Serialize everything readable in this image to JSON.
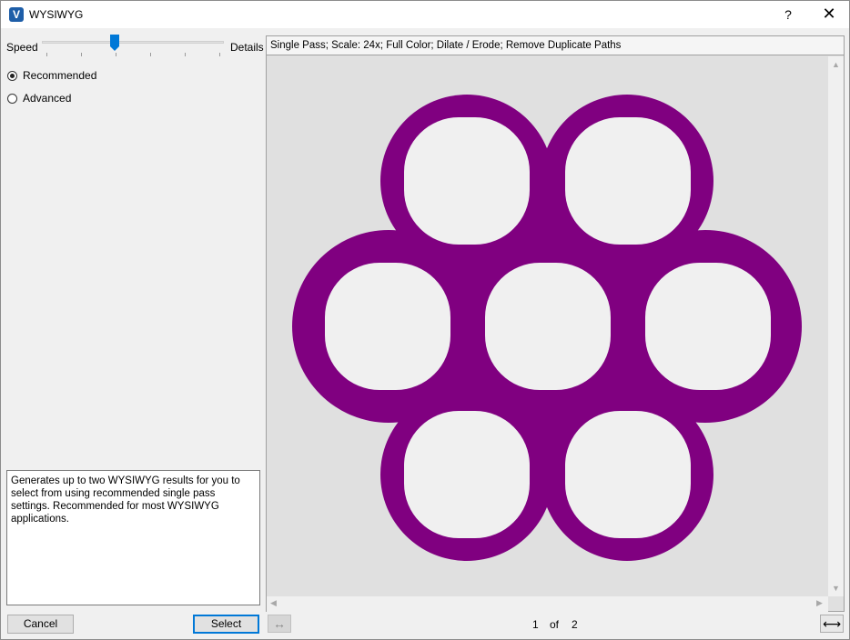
{
  "window": {
    "title": "WYSIWYG",
    "app_icon_letter": "V",
    "help_label": "?",
    "close_label": "✕"
  },
  "left_panel": {
    "slider": {
      "left_label": "Speed",
      "right_label": "Details",
      "value_fraction": 0.4
    },
    "radios": [
      {
        "label": "Recommended",
        "checked": true
      },
      {
        "label": "Advanced",
        "checked": false
      }
    ],
    "description": "Generates up to two WYSIWYG results for you to select from using recommended single pass settings. Recommended for most WYSIWYG applications."
  },
  "buttons": {
    "cancel": "Cancel",
    "select": "Select"
  },
  "preview": {
    "info": "Single Pass; Scale: 24x; Full Color; Dilate / Erode; Remove Duplicate Paths",
    "shape_color": "#800080",
    "hole_color": "#f0f0f0",
    "background_color": "#e0e0e0"
  },
  "pager": {
    "current": "1",
    "of_label": "of",
    "total": "2"
  },
  "icons": {
    "fit_left": "↔",
    "fit_right": "⟷"
  }
}
